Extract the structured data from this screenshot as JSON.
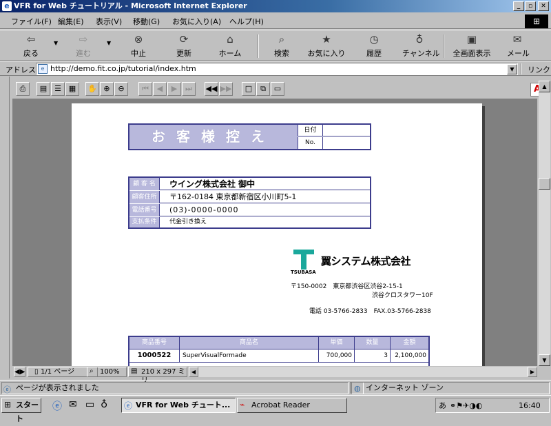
{
  "window": {
    "title": "VFR for Web チュートリアル - Microsoft Internet Explorer"
  },
  "menu": [
    "ファイル(F)",
    "編集(E)",
    "表示(V)",
    "移動(G)",
    "お気に入り(A)",
    "ヘルプ(H)"
  ],
  "toolbar": {
    "back": "戻る",
    "forward": "進む",
    "stop": "中止",
    "refresh": "更新",
    "home": "ホーム",
    "search": "検索",
    "favorites": "お気に入り",
    "history": "履歴",
    "channels": "チャンネル",
    "fullscreen": "全画面表示",
    "mail": "メール"
  },
  "address": {
    "label": "アドレス",
    "url": "http://demo.fit.co.jp/tutorial/index.htm",
    "links": "リンク"
  },
  "doc": {
    "title": "お客様控え",
    "date_label": "日付",
    "no_label": "No.",
    "customer": {
      "name_label": "顧 客 名",
      "name": "ウイング株式会社 御中",
      "addr_label": "顧客住所",
      "addr": "〒162-0184 東京都新宿区小川町5-1",
      "tel_label": "電話番号",
      "tel": "(03)-0000-0000",
      "pay_label": "支払条件",
      "pay": "代金引き換え"
    },
    "company": {
      "name": "翼システム株式会社",
      "brand": "TSUBASA",
      "addr1": "〒150-0002　東京都渋谷区渋谷2-15-1",
      "addr2": "渋谷クロスタワー10F",
      "tel": "電話 03-5766-2833　FAX.03-5766-2838"
    },
    "table": {
      "headers": [
        "商品番号",
        "商品名",
        "単価",
        "数量",
        "金額"
      ],
      "row": {
        "code": "1000522",
        "name": "SuperVisualFormade",
        "price": "700,000",
        "qty": "3",
        "amount": "2,100,000"
      }
    }
  },
  "viewer": {
    "page": "1/1 ページ",
    "zoom": "100%",
    "size": "210 x 297 ミリ"
  },
  "status": {
    "message": "ページが表示されました",
    "zone": "インターネット ゾーン"
  },
  "taskbar": {
    "start": "スタート",
    "task1": "VFR for Web チュート...",
    "task2": "Acrobat Reader",
    "clock": "16:40"
  },
  "colors": {
    "title_gradient": "#0a246a",
    "form_header": "#b8b8dc",
    "form_border": "#3c3c8c",
    "logo_teal": "#1aa89c"
  }
}
